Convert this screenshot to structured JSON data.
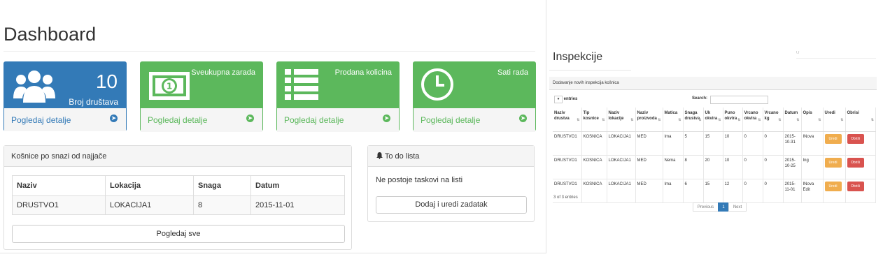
{
  "dashboard": {
    "title": "Dashboard",
    "cards": [
      {
        "number": "10",
        "label": "Broj društava",
        "footer": "Pogledaj detalje",
        "icon": "users-icon",
        "color": "#337ab7"
      },
      {
        "title": "Sveukupna zarada",
        "footer": "Pogledaj detalje",
        "icon": "money-icon",
        "color": "#5cb85c"
      },
      {
        "title": "Prodana kolicina",
        "footer": "Pogledaj detalje",
        "icon": "list-icon",
        "color": "#5cb85c"
      },
      {
        "title": "Sati rada",
        "footer": "Pogledaj detalje",
        "icon": "clock-icon",
        "color": "#5cb85c"
      }
    ],
    "hives_panel": {
      "title": "Košnice po snazi od najjače",
      "columns": [
        "Naziv",
        "Lokacija",
        "Snaga",
        "Datum"
      ],
      "rows": [
        [
          "DRUSTVO1",
          "LOKACIJA1",
          "8",
          "2015-11-01"
        ]
      ],
      "view_all": "Pogledaj sve"
    },
    "todo_panel": {
      "title": "To do lista",
      "empty_text": "Ne postoje taskovi na listi",
      "add_button": "Dodaj i uredi zadatak"
    }
  },
  "inspections": {
    "title": "Inspekcije",
    "panel_title": "Dodavanje novih inspekcija košnica",
    "entries_label": "entries",
    "search_label": "Search:",
    "top_input_text": "\\          /",
    "columns": [
      "Naziv drustva",
      "Tip kosnice",
      "Naziv lokacije",
      "Naziv proizvoda",
      "Matica",
      "Snaga drustva",
      "Uk okvira",
      "Puno okvira",
      "Vrcano okvira",
      "Vrcano kg",
      "Datum",
      "Opis",
      "Uredi",
      "Obrisi"
    ],
    "rows": [
      [
        "DRUSTVO1",
        "KOSNICA",
        "LOKACIJA1",
        "MED",
        "Ima",
        "5",
        "15",
        "10",
        "0",
        "0",
        "2015-10-31",
        "INova",
        "Uredi",
        "Obriši"
      ],
      [
        "DRUSTVO1",
        "KOSNICA",
        "LOKACIJA1",
        "MED",
        "Nema",
        "8",
        "20",
        "10",
        "0",
        "0",
        "2015-10-25",
        "Ing",
        "Uredi",
        "Obriši"
      ],
      [
        "DRUSTVO1",
        "KOSNICA",
        "LOKACIJA1",
        "MED",
        "Ima",
        "6",
        "15",
        "12",
        "0",
        "0",
        "2015-11-01",
        "INova Edit",
        "Uredi",
        "Obriši"
      ]
    ],
    "info": "3 of 3 entries",
    "pagination": {
      "previous": "Previous",
      "current": "1",
      "next": "Next"
    },
    "colors": {
      "warning": "#f0ad4e",
      "danger": "#d9534f",
      "primary": "#337ab7"
    }
  }
}
